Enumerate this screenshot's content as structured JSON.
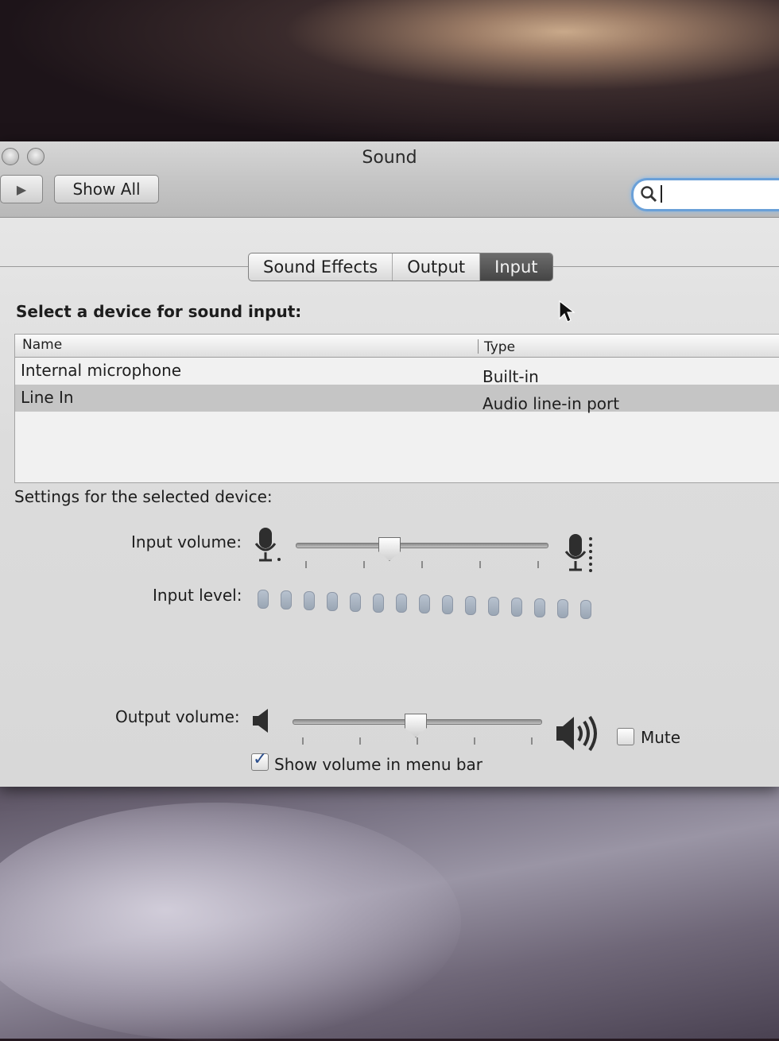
{
  "window": {
    "title": "Sound",
    "show_all_label": "Show All",
    "nav_forward_icon": "triangle-right-icon",
    "search": {
      "value": "",
      "icon": "magnifier-icon"
    }
  },
  "tabs": [
    {
      "label": "Sound Effects",
      "active": false
    },
    {
      "label": "Output",
      "active": false
    },
    {
      "label": "Input",
      "active": true
    }
  ],
  "input": {
    "device_prompt": "Select a device for sound input:",
    "table": {
      "columns": [
        "Name",
        "Type"
      ],
      "rows": [
        {
          "name": "Internal microphone",
          "type": "Built-in",
          "selected": false
        },
        {
          "name": "Line In",
          "type": "Audio line-in port",
          "selected": true
        }
      ]
    },
    "settings_label": "Settings for the selected device:",
    "input_volume_label": "Input volume:",
    "input_volume_fraction": 0.36,
    "input_level_label": "Input level:",
    "input_level_lit_segments": 0,
    "input_level_total_segments": 15
  },
  "output": {
    "output_volume_label": "Output volume:",
    "output_volume_fraction": 0.49,
    "mute_label": "Mute",
    "mute_checked": false,
    "show_volume_label": "Show volume in menu bar",
    "show_volume_checked": true
  },
  "colors": {
    "search_focus": "#6aa0d8",
    "active_tab": "#454545",
    "selected_row": "#c5c5c5",
    "level_led": "#9aa6b4"
  }
}
